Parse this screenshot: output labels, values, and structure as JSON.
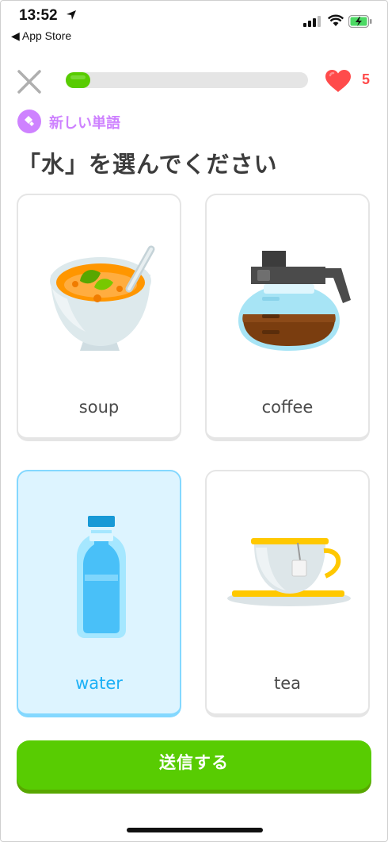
{
  "status_bar": {
    "time": "13:52",
    "back_app": "◀ App Store"
  },
  "header": {
    "progress_value": 0.1,
    "hearts": "5"
  },
  "lesson": {
    "badge_label": "新しい単語",
    "prompt": "「水」を選んでください"
  },
  "choices": [
    {
      "label": "soup",
      "icon": "soup-bowl-icon",
      "selected": false
    },
    {
      "label": "coffee",
      "icon": "coffee-pot-icon",
      "selected": false
    },
    {
      "label": "water",
      "icon": "water-bottle-icon",
      "selected": true
    },
    {
      "label": "tea",
      "icon": "tea-cup-icon",
      "selected": false
    }
  ],
  "footer": {
    "submit_label": "送信する"
  },
  "colors": {
    "accent_green": "#58cc02",
    "heart_red": "#ff4b4b",
    "badge_purple": "#ce82ff",
    "selected_blue": "#1cb0f6"
  }
}
